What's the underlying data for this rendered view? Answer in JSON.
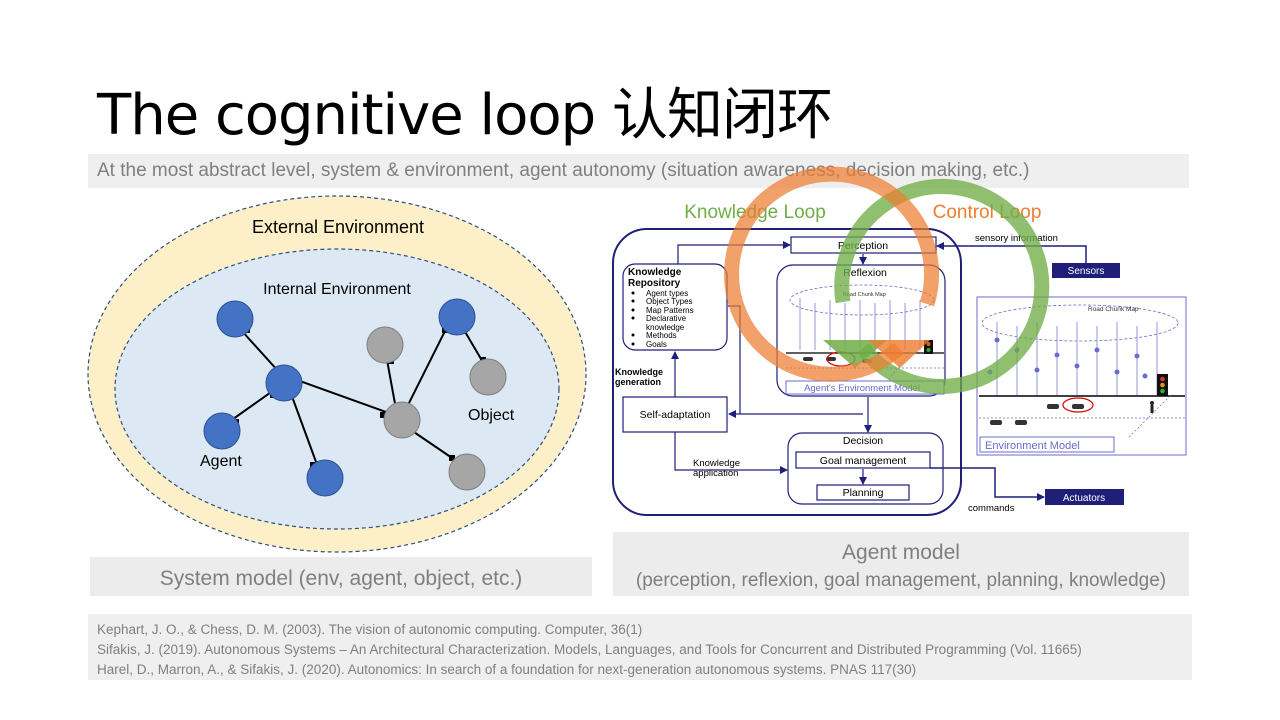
{
  "slide": {
    "title": "The cognitive loop  认知闭环",
    "subtitle": "At the most abstract level, system & environment, agent autonomy (situation awareness, decision making, etc.)"
  },
  "system_model": {
    "external_label": "External Environment",
    "internal_label": "Internal Environment",
    "agent_label": "Agent",
    "object_label": "Object",
    "caption": "System model (env, agent, object, etc.)",
    "colors": {
      "external_fill": "#fdf0c9",
      "internal_fill": "#dde8f5",
      "agent": "#4472c4",
      "object": "#a6a6a6"
    }
  },
  "agent_model": {
    "knowledge_loop_label": "Knowledge Loop",
    "control_loop_label": "Control Loop",
    "perception": "Perception",
    "sensory_information": "sensory information",
    "sensors": "Sensors",
    "knowledge_repository_title_1": "Knowledge",
    "knowledge_repository_title_2": "Repository",
    "repository_items": [
      "Agent types",
      "Object Types",
      "Map Patterns",
      "Declarative",
      "knowledge",
      "Methods",
      "Goals"
    ],
    "reflexion": "Reflexion",
    "road_chunk_map": "Road Chunk Map",
    "agents_env_model": "Agent's Environment Model",
    "environment_model": "Environment Model",
    "knowledge_generation_1": "Knowledge",
    "knowledge_generation_2": "generation",
    "self_adaptation": "Self-adaptation",
    "decision": "Decision",
    "goal_management": "Goal management",
    "planning": "Planning",
    "knowledge_application_1": "Knowledge",
    "knowledge_application_2": "application",
    "actuators": "Actuators",
    "commands": "commands",
    "caption_main": "Agent model",
    "caption_sub": "(perception, reflexion, goal management, planning, knowledge)",
    "colors": {
      "knowledge_loop": "#70ad47",
      "control_loop": "#ed7d31",
      "navy": "#1f1f7a"
    }
  },
  "references": [
    "Kephart, J. O., & Chess, D. M. (2003). The vision of autonomic computing. Computer, 36(1)",
    "Sifakis, J. (2019). Autonomous Systems – An Architectural Characterization. Models, Languages, and Tools for Concurrent and Distributed Programming (Vol. 11665)",
    "Harel, D., Marron, A., & Sifakis, J. (2020). Autonomics: In search of a foundation for next-generation autonomous systems. PNAS 117(30)"
  ]
}
